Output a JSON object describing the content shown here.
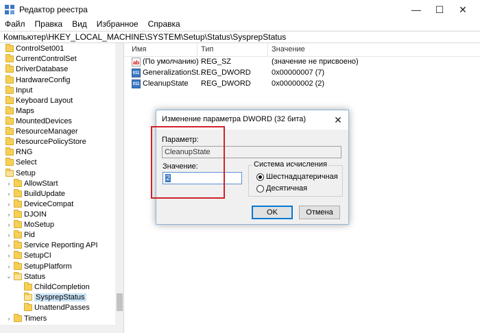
{
  "window": {
    "title": "Редактор реестра",
    "icon": "registry-editor-icon",
    "controls": {
      "minimize": "—",
      "maximize": "☐",
      "close": "✕"
    }
  },
  "menu": [
    "Файл",
    "Правка",
    "Вид",
    "Избранное",
    "Справка"
  ],
  "address": "Компьютер\\HKEY_LOCAL_MACHINE\\SYSTEM\\Setup\\Status\\SysprepStatus",
  "tree": [
    {
      "label": "ControlSet001"
    },
    {
      "label": "CurrentControlSet"
    },
    {
      "label": "DriverDatabase"
    },
    {
      "label": "HardwareConfig"
    },
    {
      "label": "Input"
    },
    {
      "label": "Keyboard Layout"
    },
    {
      "label": "Maps"
    },
    {
      "label": "MountedDevices"
    },
    {
      "label": "ResourceManager"
    },
    {
      "label": "ResourcePolicyStore"
    },
    {
      "label": "RNG"
    },
    {
      "label": "Select"
    },
    {
      "label": "Setup"
    },
    {
      "label": "AllowStart"
    },
    {
      "label": "BuildUpdate"
    },
    {
      "label": "DeviceCompat"
    },
    {
      "label": "DJOIN"
    },
    {
      "label": "MoSetup"
    },
    {
      "label": "Pid"
    },
    {
      "label": "Service Reporting API"
    },
    {
      "label": "SetupCI"
    },
    {
      "label": "SetupPlatform"
    },
    {
      "label": "Status"
    },
    {
      "label": "ChildCompletion"
    },
    {
      "label": "SysprepStatus"
    },
    {
      "label": "UnattendPasses"
    },
    {
      "label": "Timers"
    }
  ],
  "list": {
    "columns": [
      "Имя",
      "Тип",
      "Значение"
    ],
    "rows": [
      {
        "icon": "ab",
        "name": "(По умолчанию)",
        "type": "REG_SZ",
        "value": "(значение не присвоено)"
      },
      {
        "icon": "011",
        "name": "GeneralizationSt...",
        "type": "REG_DWORD",
        "value": "0x00000007 (7)"
      },
      {
        "icon": "011",
        "name": "CleanupState",
        "type": "REG_DWORD",
        "value": "0x00000002 (2)"
      }
    ]
  },
  "dialog": {
    "title": "Изменение параметра DWORD (32 бита)",
    "close": "✕",
    "param_label": "Параметр:",
    "param_value": "CleanupState",
    "value_label": "Значение:",
    "value": "2",
    "base_group": "Система исчисления",
    "radio_hex": "Шестнадцатеричная",
    "radio_dec": "Десятичная",
    "ok": "OK",
    "cancel": "Отмена"
  },
  "colors": {
    "highlight": "#d0202a",
    "selection": "#cce4f7",
    "accent": "#0078d7"
  }
}
